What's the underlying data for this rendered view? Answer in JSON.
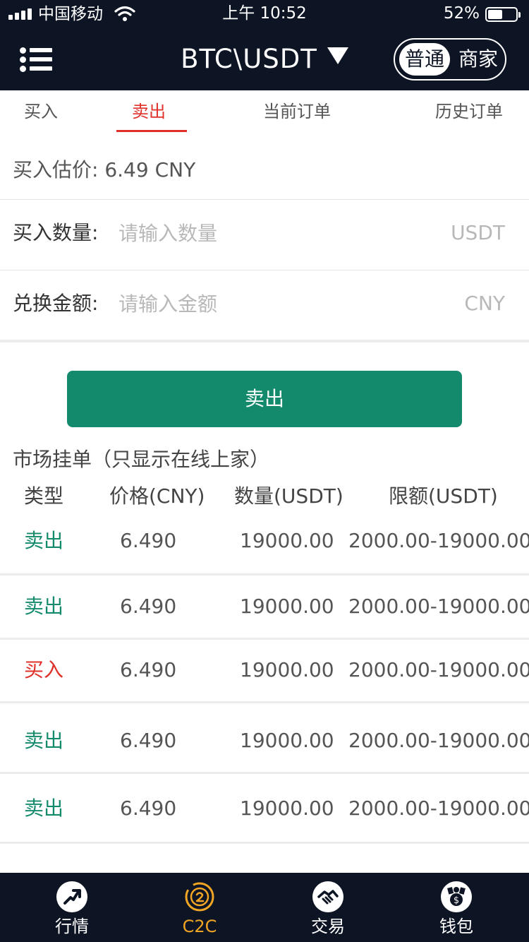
{
  "status_bar": {
    "carrier": "中国移动",
    "time": "上午 10:52",
    "battery_pct": "52%",
    "battery_level": 0.52
  },
  "nav": {
    "pair": "BTC\\USDT",
    "mode_options": [
      "普通",
      "商家"
    ],
    "active_mode": "普通"
  },
  "tabs": [
    {
      "label": "买入"
    },
    {
      "label": "卖出"
    },
    {
      "label": "当前订单"
    },
    {
      "label": "历史订单"
    }
  ],
  "active_tab": "卖出",
  "estimate": {
    "label": "买入估价:",
    "value": "6.49",
    "unit": "CNY"
  },
  "form": {
    "quantity": {
      "label": "买入数量:",
      "placeholder": "请输入数量",
      "unit": "USDT",
      "value": ""
    },
    "amount": {
      "label": "兑换金额:",
      "placeholder": "请输入金额",
      "unit": "CNY",
      "value": ""
    }
  },
  "sell_button": "卖出",
  "market": {
    "title": "市场挂单（只显示在线上家）",
    "headers": [
      "类型",
      "价格(CNY)",
      "数量(USDT)",
      "限额(USDT)"
    ],
    "rows": [
      {
        "type": "卖出",
        "side": "sell",
        "price": "6.490",
        "quantity": "19000.00",
        "limit": "2000.00-19000.00"
      },
      {
        "type": "卖出",
        "side": "sell",
        "price": "6.490",
        "quantity": "19000.00",
        "limit": "2000.00-19000.00"
      },
      {
        "type": "买入",
        "side": "buy",
        "price": "6.490",
        "quantity": "19000.00",
        "limit": "2000.00-19000.00"
      },
      {
        "type": "卖出",
        "side": "sell",
        "price": "6.490",
        "quantity": "19000.00",
        "limit": "2000.00-19000.00"
      },
      {
        "type": "卖出",
        "side": "sell",
        "price": "6.490",
        "quantity": "19000.00",
        "limit": "2000.00-19000.00"
      }
    ]
  },
  "bottom_nav": [
    {
      "label": "行情",
      "icon": "market-trend-icon"
    },
    {
      "label": "C2C",
      "icon": "c2c-icon"
    },
    {
      "label": "交易",
      "icon": "handshake-icon"
    },
    {
      "label": "钱包",
      "icon": "wallet-icon"
    }
  ],
  "active_bottom": "C2C",
  "colors": {
    "header_bg": "#0d1424",
    "sell_green": "#148a6c",
    "buy_red": "#e0302a",
    "active_tab_red": "#e0302a",
    "active_bottom_gold": "#f0a524"
  }
}
